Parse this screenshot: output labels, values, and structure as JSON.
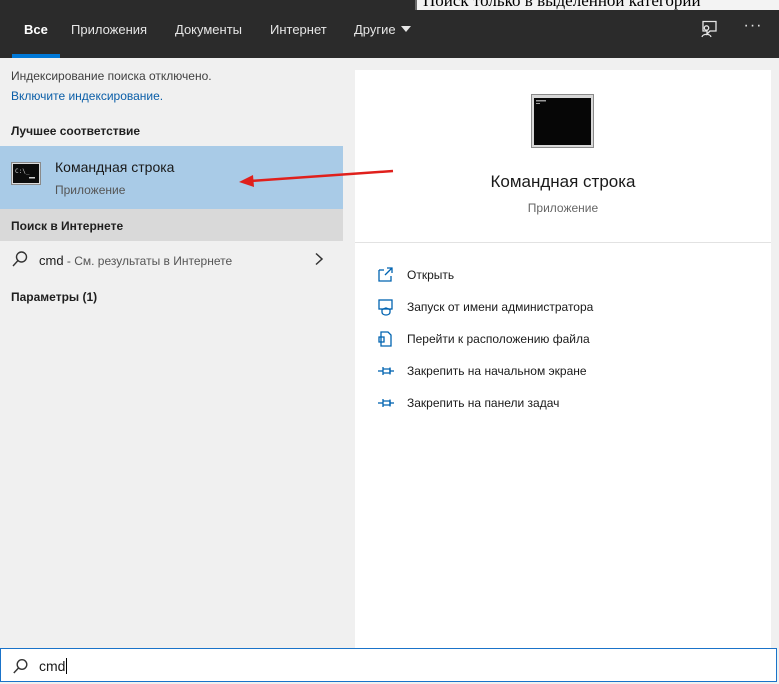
{
  "background_window": {
    "text": "Поиск только в выделенной категории"
  },
  "tabs": [
    {
      "label": "Все",
      "active": true
    },
    {
      "label": "Приложения",
      "active": false
    },
    {
      "label": "Документы",
      "active": false
    },
    {
      "label": "Интернет",
      "active": false
    },
    {
      "label": "Другие",
      "active": false,
      "dropdown": true
    }
  ],
  "toolbar": {
    "feedback_icon": "feedback-icon",
    "more_icon": "more-options-icon",
    "more_label": "···"
  },
  "left_panel": {
    "index_notice": "Индексирование поиска отключено.",
    "index_link": "Включите индексирование.",
    "best_match_header": "Лучшее соответствие",
    "best_match": {
      "title": "Командная строка",
      "subtitle": "Приложение",
      "icon": "command-prompt-icon"
    },
    "web_header": "Поиск в Интернете",
    "web_result": {
      "query": "cmd",
      "hint": " - См. результаты в Интернете"
    },
    "params_header": "Параметры (1)"
  },
  "preview": {
    "title": "Командная строка",
    "subtitle": "Приложение",
    "actions": [
      {
        "label": "Открыть",
        "icon": "open-icon"
      },
      {
        "label": "Запуск от имени администратора",
        "icon": "run-as-admin-icon"
      },
      {
        "label": "Перейти к расположению файла",
        "icon": "file-location-icon"
      },
      {
        "label": "Закрепить на начальном экране",
        "icon": "pin-icon"
      },
      {
        "label": "Закрепить на панели задач",
        "icon": "pin-icon"
      }
    ]
  },
  "search": {
    "value": "cmd",
    "icon": "search-icon"
  },
  "colors": {
    "accent": "#0078d7",
    "selection": "#a9cbe7",
    "annotation_arrow": "#e0201c",
    "topbar": "#2b2b2b"
  }
}
